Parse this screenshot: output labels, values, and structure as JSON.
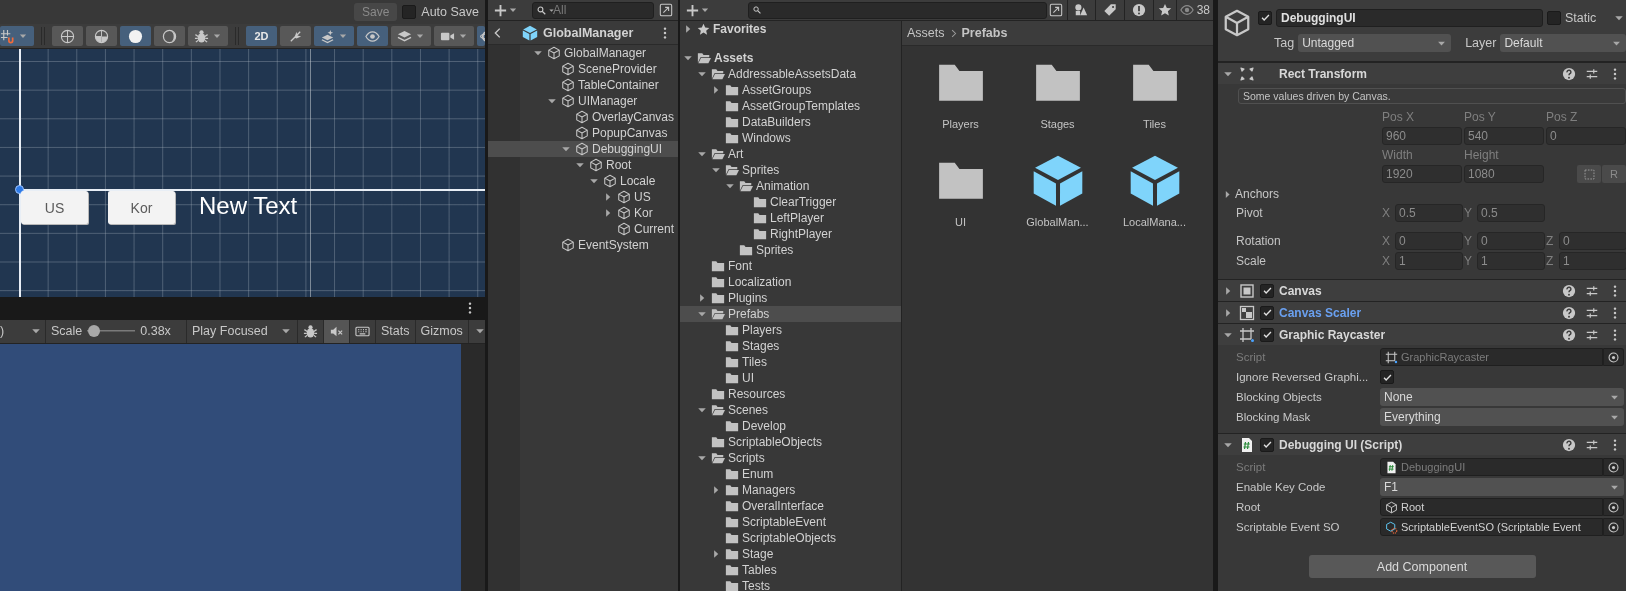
{
  "scene_view": {
    "save_button": "Save",
    "auto_save": {
      "label": "Auto Save",
      "checked": false
    },
    "tools": [
      {
        "kind": "snap",
        "selected": true,
        "dropdown": true
      },
      {
        "kind": "separator"
      },
      {
        "kind": "wire-globe",
        "selected": false
      },
      {
        "kind": "shaded-globe",
        "selected": false
      },
      {
        "kind": "sphere",
        "selected": true
      },
      {
        "kind": "crescent",
        "selected": false
      },
      {
        "kind": "bug",
        "selected": false,
        "dropdown": true
      },
      {
        "kind": "separator"
      },
      {
        "kind": "text",
        "label": "2D",
        "selected": true
      },
      {
        "kind": "light",
        "selected": false
      },
      {
        "kind": "layers-sparkle",
        "selected": true,
        "dropdown": true
      },
      {
        "kind": "eye",
        "selected": true
      },
      {
        "kind": "layers",
        "selected": false,
        "dropdown": true
      },
      {
        "kind": "camera",
        "selected": false,
        "dropdown": true
      },
      {
        "kind": "gizmo",
        "selected": true
      }
    ],
    "canvas": {
      "buttons": [
        "US",
        "Kor"
      ],
      "text": "New Text"
    }
  },
  "game_view": {
    "resolution_text": ")",
    "scale": {
      "label": "Scale",
      "level": 0.03,
      "reading": "0.38x"
    },
    "play_mode": "Play Focused",
    "toggles": [
      {
        "kind": "bug",
        "selected": false
      },
      {
        "kind": "mute",
        "selected": true
      },
      {
        "kind": "keyboard",
        "selected": false
      }
    ],
    "stats": "Stats",
    "gizmos": "Gizmos"
  },
  "hierarchy": {
    "search": {
      "placeholder": "All"
    },
    "prefab_title": "GlobalManager",
    "tree": [
      {
        "name": "GlobalManager",
        "expanded": true,
        "selected": false,
        "children": [
          {
            "name": "SceneProvider",
            "selected": false
          },
          {
            "name": "TableContainer",
            "selected": false
          },
          {
            "name": "UIManager",
            "expanded": true,
            "selected": false,
            "children": [
              {
                "name": "OverlayCanvas",
                "selected": false
              },
              {
                "name": "PopupCanvas",
                "selected": false
              },
              {
                "name": "DebuggingUI",
                "expanded": true,
                "selected": true,
                "children": [
                  {
                    "name": "Root",
                    "expanded": true,
                    "selected": false,
                    "children": [
                      {
                        "name": "Locale",
                        "expanded": true,
                        "selected": false,
                        "children": [
                          {
                            "name": "US",
                            "expanded": false,
                            "selected": false
                          },
                          {
                            "name": "Kor",
                            "expanded": false,
                            "selected": false
                          },
                          {
                            "name": "Current",
                            "selected": false
                          }
                        ]
                      }
                    ]
                  }
                ]
              }
            ]
          },
          {
            "name": "EventSystem",
            "selected": false
          }
        ]
      }
    ]
  },
  "project": {
    "favorites": {
      "label": "Favorites",
      "expanded": false
    },
    "tree": [
      {
        "name": "Assets",
        "expanded": true,
        "selected": false,
        "children": [
          {
            "name": "AddressableAssetsData",
            "expanded": true,
            "selected": false,
            "children": [
              {
                "name": "AssetGroups",
                "expanded": false,
                "selected": false
              },
              {
                "name": "AssetGroupTemplates",
                "selected": false
              },
              {
                "name": "DataBuilders",
                "selected": false
              },
              {
                "name": "Windows",
                "selected": false
              }
            ]
          },
          {
            "name": "Art",
            "expanded": true,
            "selected": false,
            "children": [
              {
                "name": "Sprites",
                "expanded": true,
                "selected": false,
                "children": [
                  {
                    "name": "Animation",
                    "expanded": true,
                    "selected": false,
                    "children": [
                      {
                        "name": "ClearTrigger",
                        "selected": false
                      },
                      {
                        "name": "LeftPlayer",
                        "selected": false
                      },
                      {
                        "name": "RightPlayer",
                        "selected": false
                      }
                    ]
                  },
                  {
                    "name": "Sprites",
                    "selected": false
                  }
                ]
              }
            ]
          },
          {
            "name": "Font",
            "selected": false
          },
          {
            "name": "Localization",
            "selected": false
          },
          {
            "name": "Plugins",
            "expanded": false,
            "selected": false
          },
          {
            "name": "Prefabs",
            "expanded": true,
            "selected": true,
            "children": [
              {
                "name": "Players",
                "selected": false
              },
              {
                "name": "Stages",
                "selected": false
              },
              {
                "name": "Tiles",
                "selected": false
              },
              {
                "name": "UI",
                "selected": false
              }
            ]
          },
          {
            "name": "Resources",
            "selected": false
          },
          {
            "name": "Scenes",
            "expanded": true,
            "selected": false,
            "children": [
              {
                "name": "Develop",
                "selected": false
              }
            ]
          },
          {
            "name": "ScriptableObjects",
            "selected": false
          },
          {
            "name": "Scripts",
            "expanded": true,
            "selected": false,
            "children": [
              {
                "name": "Enum",
                "selected": false
              },
              {
                "name": "Managers",
                "expanded": false,
                "selected": false
              },
              {
                "name": "OveralInterface",
                "selected": false
              },
              {
                "name": "ScriptableEvent",
                "selected": false
              },
              {
                "name": "ScriptableObjects",
                "selected": false
              },
              {
                "name": "Stage",
                "expanded": false,
                "selected": false
              },
              {
                "name": "Tables",
                "selected": false
              },
              {
                "name": "Tests",
                "selected": false
              }
            ]
          }
        ]
      }
    ],
    "breadcrumb": [
      "Assets",
      "Prefabs"
    ],
    "items": [
      {
        "name": "Players",
        "kind": "folder"
      },
      {
        "name": "Stages",
        "kind": "folder"
      },
      {
        "name": "Tiles",
        "kind": "folder"
      },
      {
        "name": "UI",
        "kind": "folder"
      },
      {
        "name": "GlobalMan...",
        "kind": "prefab"
      },
      {
        "name": "LocalMana...",
        "kind": "prefab"
      }
    ],
    "visible_count": "38"
  },
  "inspector": {
    "active": true,
    "name": "DebuggingUI",
    "static": {
      "label": "Static",
      "checked": false
    },
    "tag": {
      "label": "Tag",
      "value": "Untagged"
    },
    "layer": {
      "label": "Layer",
      "value": "Default"
    },
    "components": [
      {
        "kind": "rect-transform",
        "title": "Rect Transform",
        "expanded": true,
        "overridden": false,
        "note": "Some values driven by Canvas.",
        "position": [
          {
            "label": "Pos X",
            "value": "960"
          },
          {
            "label": "Pos Y",
            "value": "540"
          },
          {
            "label": "Pos Z",
            "value": "0"
          }
        ],
        "size": [
          {
            "label": "Width",
            "value": "1920"
          },
          {
            "label": "Height",
            "value": "1080"
          }
        ],
        "raw_button": "R",
        "anchors": {
          "label": "Anchors",
          "expanded": false
        },
        "vectors": [
          {
            "label": "Pivot",
            "axes": [
              {
                "label": "X",
                "value": "0.5"
              },
              {
                "label": "Y",
                "value": "0.5"
              }
            ]
          },
          {
            "label": "Rotation",
            "axes": [
              {
                "label": "X",
                "value": "0"
              },
              {
                "label": "Y",
                "value": "0"
              },
              {
                "label": "Z",
                "value": "0"
              }
            ]
          },
          {
            "label": "Scale",
            "axes": [
              {
                "label": "X",
                "value": "1"
              },
              {
                "label": "Y",
                "value": "1"
              },
              {
                "label": "Z",
                "value": "1"
              }
            ]
          }
        ]
      },
      {
        "kind": "canvas",
        "title": "Canvas",
        "expanded": false,
        "enabled": true,
        "overridden": false
      },
      {
        "kind": "canvas-scaler",
        "title": "Canvas Scaler",
        "expanded": false,
        "enabled": true,
        "overridden": true
      },
      {
        "kind": "graphic-raycaster",
        "title": "Graphic Raycaster",
        "expanded": true,
        "enabled": true,
        "overridden": false,
        "properties": [
          {
            "kind": "script",
            "label": "Script",
            "value": "GraphicRaycaster"
          },
          {
            "kind": "toggle",
            "label": "Ignore Reversed Graphi...",
            "checked": true
          },
          {
            "kind": "dropdown",
            "label": "Blocking Objects",
            "value": "None"
          },
          {
            "kind": "dropdown",
            "label": "Blocking Mask",
            "value": "Everything"
          }
        ]
      },
      {
        "kind": "script",
        "title": "Debugging UI (Script)",
        "expanded": true,
        "enabled": true,
        "overridden": false,
        "properties": [
          {
            "kind": "script",
            "label": "Script",
            "value": "DebuggingUI"
          },
          {
            "kind": "dropdown",
            "label": "Enable Key Code",
            "value": "F1"
          },
          {
            "kind": "gameobject",
            "label": "Root",
            "value": "Root"
          },
          {
            "kind": "asset",
            "label": "Scriptable Event SO",
            "value": "ScriptableEventSO (Scriptable Event"
          }
        ]
      }
    ],
    "add_component": "Add Component"
  }
}
